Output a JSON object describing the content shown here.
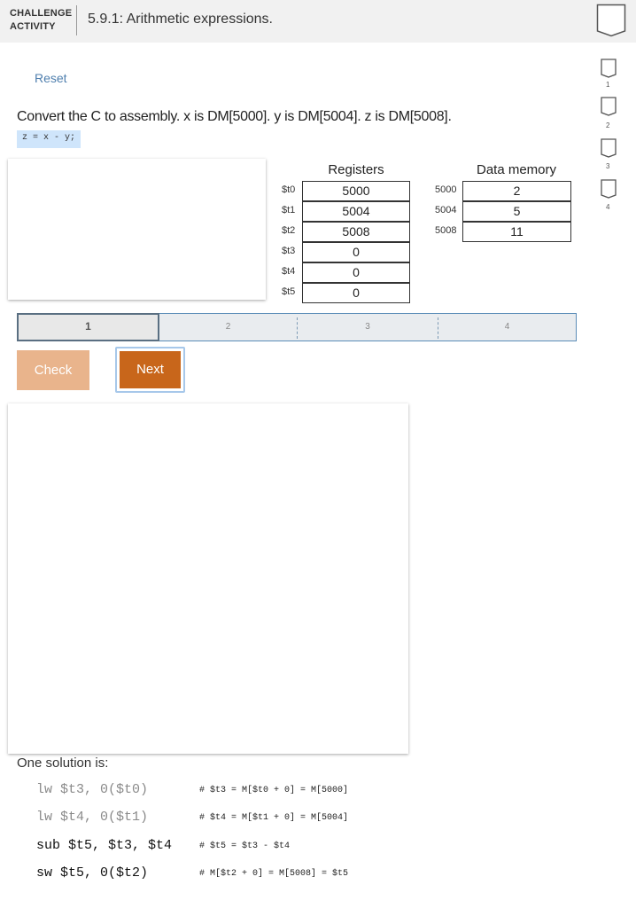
{
  "header": {
    "badge_line1": "CHALLENGE",
    "badge_line2": "ACTIVITY",
    "title": "5.9.1: Arithmetic expressions."
  },
  "reset_label": "Reset",
  "instruction": "Convert the C to assembly. x is DM[5000]. y is DM[5004]. z is DM[5008].",
  "c_code": "z = x - y;",
  "registers": {
    "title": "Registers",
    "rows": [
      {
        "name": "$t0",
        "value": "5000"
      },
      {
        "name": "$t1",
        "value": "5004"
      },
      {
        "name": "$t2",
        "value": "5008"
      },
      {
        "name": "$t3",
        "value": "0"
      },
      {
        "name": "$t4",
        "value": "0"
      },
      {
        "name": "$t5",
        "value": "0"
      }
    ]
  },
  "memory": {
    "title": "Data memory",
    "rows": [
      {
        "address": "5000",
        "value": "2"
      },
      {
        "address": "5004",
        "value": "5"
      },
      {
        "address": "5008",
        "value": "11"
      }
    ]
  },
  "progress": {
    "levels": [
      "1",
      "2",
      "3",
      "4"
    ],
    "current": "1"
  },
  "buttons": {
    "check": "Check",
    "next": "Next"
  },
  "solution": {
    "label": "One solution is:",
    "lines": [
      {
        "code": "lw $t3, 0($t0)",
        "comment": "# $t3 = M[$t0 + 0] = M[5000]"
      },
      {
        "code": "lw $t4, 0($t1)",
        "comment": "# $t4 = M[$t1 + 0] = M[5004]"
      },
      {
        "code": "sub $t5, $t3, $t4",
        "comment": "# $t5 = $t3 - $t4"
      },
      {
        "code": "sw $t5, 0($t2)",
        "comment": "# M[$t2 + 0] = M[5008] = $t5"
      }
    ]
  },
  "side_levels": [
    "1",
    "2",
    "3",
    "4"
  ],
  "colors": {
    "header_bg": "#f1f1f1",
    "link": "#4f7fae",
    "code_highlight": "#cfe5fb",
    "check_button": "#e9b48c",
    "next_button": "#c8661b",
    "progress_border": "#5b8db8"
  }
}
